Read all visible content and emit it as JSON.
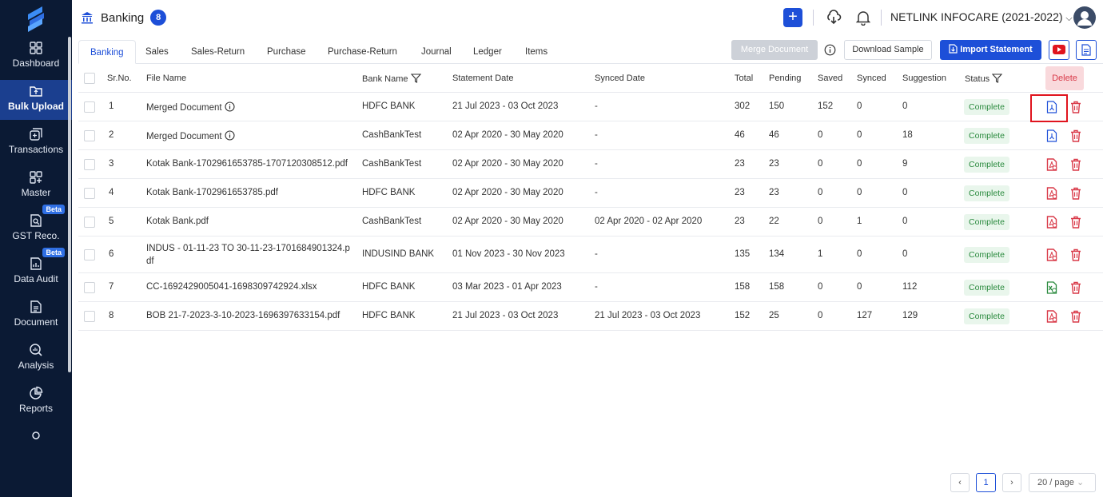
{
  "sidebar": {
    "items": [
      {
        "label": "Dashboard",
        "icon": "dashboard-icon"
      },
      {
        "label": "Bulk Upload",
        "icon": "upload-folder-icon",
        "active": true
      },
      {
        "label": "Transactions",
        "icon": "transactions-icon"
      },
      {
        "label": "Master",
        "icon": "grid-add-icon"
      },
      {
        "label": "GST Reco.",
        "icon": "gst-search-icon",
        "badge": "Beta"
      },
      {
        "label": "Data Audit",
        "icon": "audit-icon",
        "badge": "Beta"
      },
      {
        "label": "Document",
        "icon": "document-icon"
      },
      {
        "label": "Analysis",
        "icon": "analysis-icon"
      },
      {
        "label": "Reports",
        "icon": "pie-chart-icon"
      }
    ]
  },
  "header": {
    "title": "Banking",
    "count": "8",
    "company": "NETLINK INFOCARE (2021-2022)"
  },
  "tabs": [
    "Banking",
    "Sales",
    "Sales-Return",
    "Purchase",
    "Purchase-Return",
    "Journal",
    "Ledger",
    "Items"
  ],
  "toolbar": {
    "merge_label": "Merge Document",
    "sample_label": "Download Sample",
    "import_label": "Import Statement"
  },
  "table": {
    "headers": {
      "sr": "Sr.No.",
      "file": "File Name",
      "bank": "Bank Name",
      "statement": "Statement Date",
      "synced_date": "Synced Date",
      "total": "Total",
      "pending": "Pending",
      "saved": "Saved",
      "synced": "Synced",
      "suggestion": "Suggestion",
      "status": "Status",
      "delete": "Delete"
    },
    "rows": [
      {
        "sr": "1",
        "file": "Merged Document",
        "info": true,
        "bank": "HDFC BANK",
        "statement": "21 Jul 2023 - 03 Oct 2023",
        "synced_date": "-",
        "total": "302",
        "pending": "150",
        "saved": "152",
        "synced": "0",
        "suggestion": "0",
        "status": "Complete",
        "type": "merged"
      },
      {
        "sr": "2",
        "file": "Merged Document",
        "info": true,
        "bank": "CashBankTest",
        "statement": "02 Apr 2020 - 30 May 2020",
        "synced_date": "-",
        "total": "46",
        "pending": "46",
        "saved": "0",
        "synced": "0",
        "suggestion": "18",
        "status": "Complete",
        "type": "merged"
      },
      {
        "sr": "3",
        "file": "Kotak Bank-1702961653785-1707120308512.pdf",
        "bank": "CashBankTest",
        "statement": "02 Apr 2020 - 30 May 2020",
        "synced_date": "-",
        "total": "23",
        "pending": "23",
        "saved": "0",
        "synced": "0",
        "suggestion": "9",
        "status": "Complete",
        "type": "pdf"
      },
      {
        "sr": "4",
        "file": "Kotak Bank-1702961653785.pdf",
        "bank": "HDFC BANK",
        "statement": "02 Apr 2020 - 30 May 2020",
        "synced_date": "-",
        "total": "23",
        "pending": "23",
        "saved": "0",
        "synced": "0",
        "suggestion": "0",
        "status": "Complete",
        "type": "pdf"
      },
      {
        "sr": "5",
        "file": "Kotak Bank.pdf",
        "bank": "CashBankTest",
        "statement": "02 Apr 2020 - 30 May 2020",
        "synced_date": "02 Apr 2020 - 02 Apr 2020",
        "total": "23",
        "pending": "22",
        "saved": "0",
        "synced": "1",
        "suggestion": "0",
        "status": "Complete",
        "type": "pdf"
      },
      {
        "sr": "6",
        "file": "INDUS - 01-11-23 TO 30-11-23-1701684901324.p",
        "file2": "df",
        "bank": "INDUSIND BANK",
        "statement": "01 Nov 2023 - 30 Nov 2023",
        "synced_date": "-",
        "total": "135",
        "pending": "134",
        "saved": "1",
        "synced": "0",
        "suggestion": "0",
        "status": "Complete",
        "type": "pdf"
      },
      {
        "sr": "7",
        "file": "CC-1692429005041-1698309742924.xlsx",
        "bank": "HDFC BANK",
        "statement": "03 Mar 2023 - 01 Apr 2023",
        "synced_date": "-",
        "total": "158",
        "pending": "158",
        "saved": "0",
        "synced": "0",
        "suggestion": "112",
        "status": "Complete",
        "type": "xlsx"
      },
      {
        "sr": "8",
        "file": "BOB 21-7-2023-3-10-2023-1696397633154.pdf",
        "bank": "HDFC BANK",
        "statement": "21 Jul 2023 - 03 Oct 2023",
        "synced_date": "21 Jul 2023 - 03 Oct 2023",
        "total": "152",
        "pending": "25",
        "saved": "0",
        "synced": "127",
        "suggestion": "129",
        "status": "Complete",
        "type": "pdf"
      }
    ]
  },
  "pagination": {
    "page": "1",
    "page_size": "20 / page"
  },
  "colors": {
    "sidebar": "#0b1a34",
    "accent": "#1d4fd8",
    "danger": "#d93a49",
    "success": "#2a8a3e"
  }
}
